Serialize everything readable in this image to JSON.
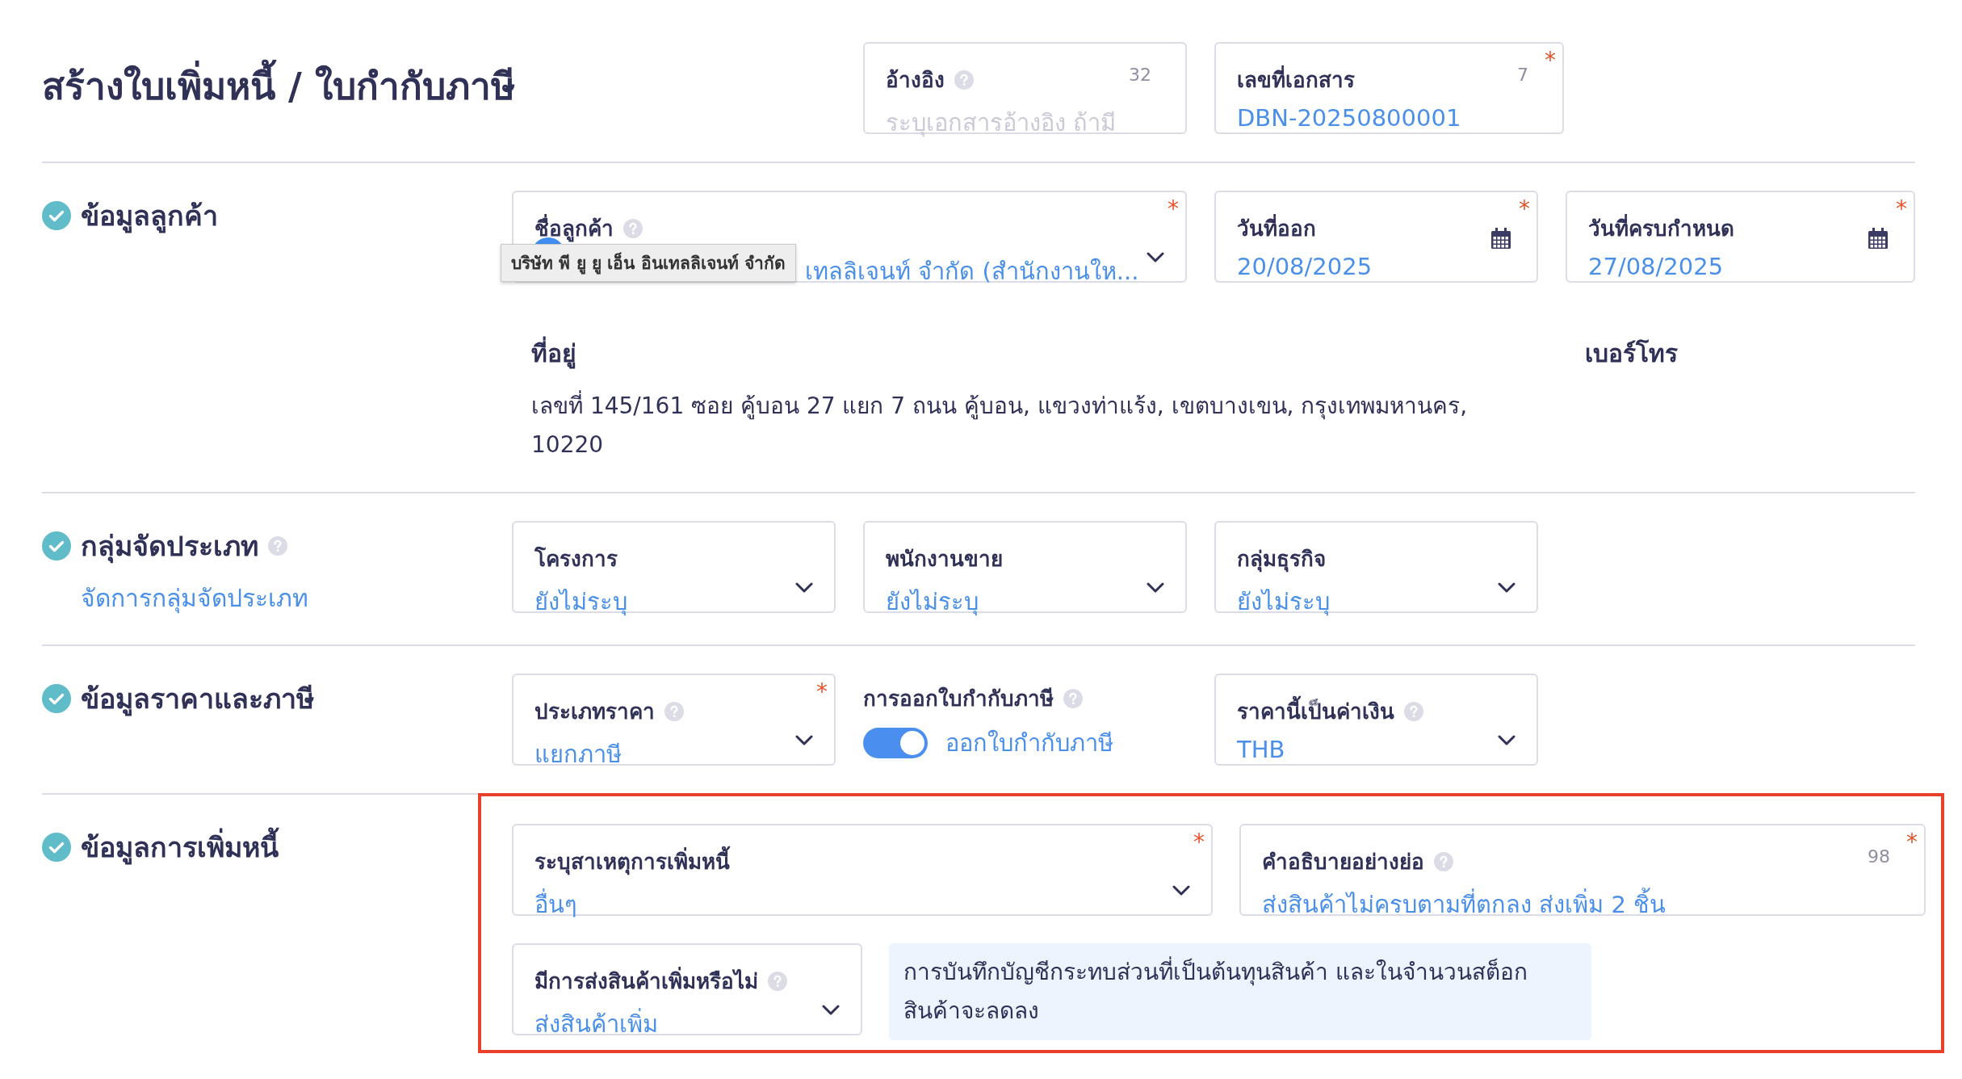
{
  "title": "สร้างใบเพิ่มหนี้ / ใบกำกับภาษี",
  "required_symbol": "*",
  "header_fields": [
    {
      "kind": "text",
      "label": "อ้างอิง",
      "help": true,
      "counter": "32",
      "placeholder": "ระบุเอกสารอ้างอิง ถ้ามี",
      "required": false
    },
    {
      "kind": "text",
      "label": "เลขที่เอกสาร",
      "help": false,
      "counter": "7",
      "value": "DBN-20250800001",
      "required": true
    }
  ],
  "sections": [
    {
      "kind": "customer",
      "heading": "ข้อมูลลูกค้า",
      "completed": true,
      "help": false,
      "highlighted": false,
      "fields": [
        {
          "kind": "select",
          "label": "ชื่อลูกค้า",
          "help": true,
          "required": true,
          "value": "เทลลิเจนท์ จำกัด (สำนักงานให...",
          "tooltip": "บริษัท พี ยู ยู เอ็น อินเทลลิเจนท์ จำกัด"
        },
        {
          "kind": "date",
          "label": "วันที่ออก",
          "help": false,
          "required": true,
          "value": "20/08/2025"
        },
        {
          "kind": "date",
          "label": "วันที่ครบกำหนด",
          "help": false,
          "required": true,
          "value": "27/08/2025"
        },
        {
          "kind": "detail",
          "label": "ที่อยู่",
          "text": "เลขที่ 145/161 ซอย คู้บอน 27 แยก 7 ถนน คู้บอน, แขวงท่าแร้ง, เขตบางเขน, กรุงเทพมหานคร, 10220"
        },
        {
          "kind": "detail",
          "label": "เบอร์โทร"
        }
      ]
    },
    {
      "kind": "classification",
      "heading": "กลุ่มจัดประเภท",
      "completed": true,
      "help": true,
      "highlighted": false,
      "link": "จัดการกลุ่มจัดประเภท",
      "fields": [
        {
          "kind": "select",
          "label": "โครงการ",
          "help": false,
          "required": false,
          "value": "ยังไม่ระบุ"
        },
        {
          "kind": "select",
          "label": "พนักงานขาย",
          "help": false,
          "required": false,
          "value": "ยังไม่ระบุ"
        },
        {
          "kind": "select",
          "label": "กลุ่มธุรกิจ",
          "help": false,
          "required": false,
          "value": "ยังไม่ระบุ"
        }
      ]
    },
    {
      "kind": "pricing",
      "heading": "ข้อมูลราคาและภาษี",
      "completed": true,
      "help": false,
      "highlighted": false,
      "fields": [
        {
          "kind": "select",
          "label": "ประเภทราคา",
          "help": true,
          "required": true,
          "value": "แยกภาษี"
        },
        {
          "kind": "toggle",
          "label": "การออกใบกำกับภาษี",
          "help": true,
          "on": true,
          "text": "ออกใบกำกับภาษี"
        },
        {
          "kind": "select",
          "label": "ราคานี้เป็นค่าเงิน",
          "help": true,
          "required": false,
          "value": "THB"
        }
      ]
    },
    {
      "kind": "debit",
      "heading": "ข้อมูลการเพิ่มหนี้",
      "completed": true,
      "help": false,
      "highlighted": true,
      "fields": [
        {
          "kind": "select",
          "label": "ระบุสาเหตุการเพิ่มหนี้",
          "help": false,
          "required": true,
          "value": "อื่นๆ"
        },
        {
          "kind": "text",
          "label": "คำอธิบายอย่างย่อ",
          "help": true,
          "required": true,
          "counter": "98",
          "value": "ส่งสินค้าไม่ครบตามที่ตกลง ส่งเพิ่ม 2 ชิ้น"
        },
        {
          "kind": "select",
          "label": "มีการส่งสินค้าเพิ่มหรือไม่",
          "help": true,
          "required": false,
          "value": "ส่งสินค้าเพิ่ม"
        },
        {
          "kind": "note",
          "text": "การบันทึกบัญชีกระทบส่วนที่เป็นต้นทุนสินค้า และในจำนวนสต็อก สินค้าจะลดลง"
        }
      ]
    }
  ]
}
